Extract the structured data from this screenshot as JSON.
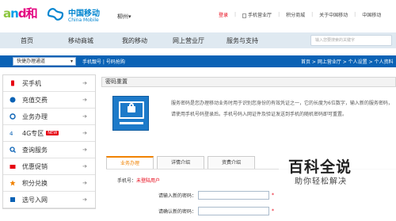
{
  "header": {
    "and_logo_a": "a",
    "and_logo_n": "n",
    "and_logo_d": "d",
    "and_logo_he": "和",
    "brand_cn": "中国移动",
    "brand_en": "China Mobile",
    "city": "柳州▾",
    "login": "登录",
    "links": [
      "手机营业厅",
      "积分商城",
      "关于中国移动",
      "中国移动"
    ]
  },
  "nav": {
    "items": [
      "首页",
      "移动商城",
      "我的移动",
      "网上营业厅",
      "服务与支持"
    ],
    "search_placeholder": "输入您要搜索的关键字"
  },
  "toolbar": {
    "quick_select": "快捷办理通道",
    "quick_arrow": "▾",
    "links": "手机靓号 | 号码抢购",
    "breadcrumb": "首页 > 网上营业厅 > 个人设置 > 个人资料"
  },
  "sidebar": {
    "items": [
      {
        "label": "买手机",
        "icon": "phone-icon"
      },
      {
        "label": "充值交费",
        "icon": "recharge-icon"
      },
      {
        "label": "业务办理",
        "icon": "service-icon"
      },
      {
        "label": "4G专区",
        "icon": "4g-icon",
        "badge": "NEW"
      },
      {
        "label": "查询服务",
        "icon": "query-icon"
      },
      {
        "label": "优惠促销",
        "icon": "promotion-icon"
      },
      {
        "label": "积分兑换",
        "icon": "points-icon"
      },
      {
        "label": "选号入网",
        "icon": "number-icon"
      }
    ],
    "arrow": "➔"
  },
  "panel": {
    "title": "密码重置",
    "description": "服务密码是您办理移动业务时用于识别您身份的有效凭证之一，它的长度为6位数字，输入新的服务密码，请使用手机号码登录后。手机号码入网证件及验证发送到手机的随机密码即可重置。",
    "tabs": [
      "业务办理",
      "详情介绍",
      "资费介绍"
    ],
    "phone_label": "手机号：",
    "phone_value": "未登陆用户",
    "fields": [
      {
        "label": "请输入新的密码：",
        "star": "*"
      },
      {
        "label": "请确认新的密码：",
        "star": "*"
      }
    ]
  },
  "watermark": {
    "title": "百科全说",
    "subtitle": "助你轻松解决"
  },
  "colors": {
    "nav_bg": "#dfe9f1",
    "toolbar_bg": "#0a62b5",
    "brand_blue": "#0085d0",
    "accent_orange": "#f08200",
    "alert_red": "#e60012"
  }
}
